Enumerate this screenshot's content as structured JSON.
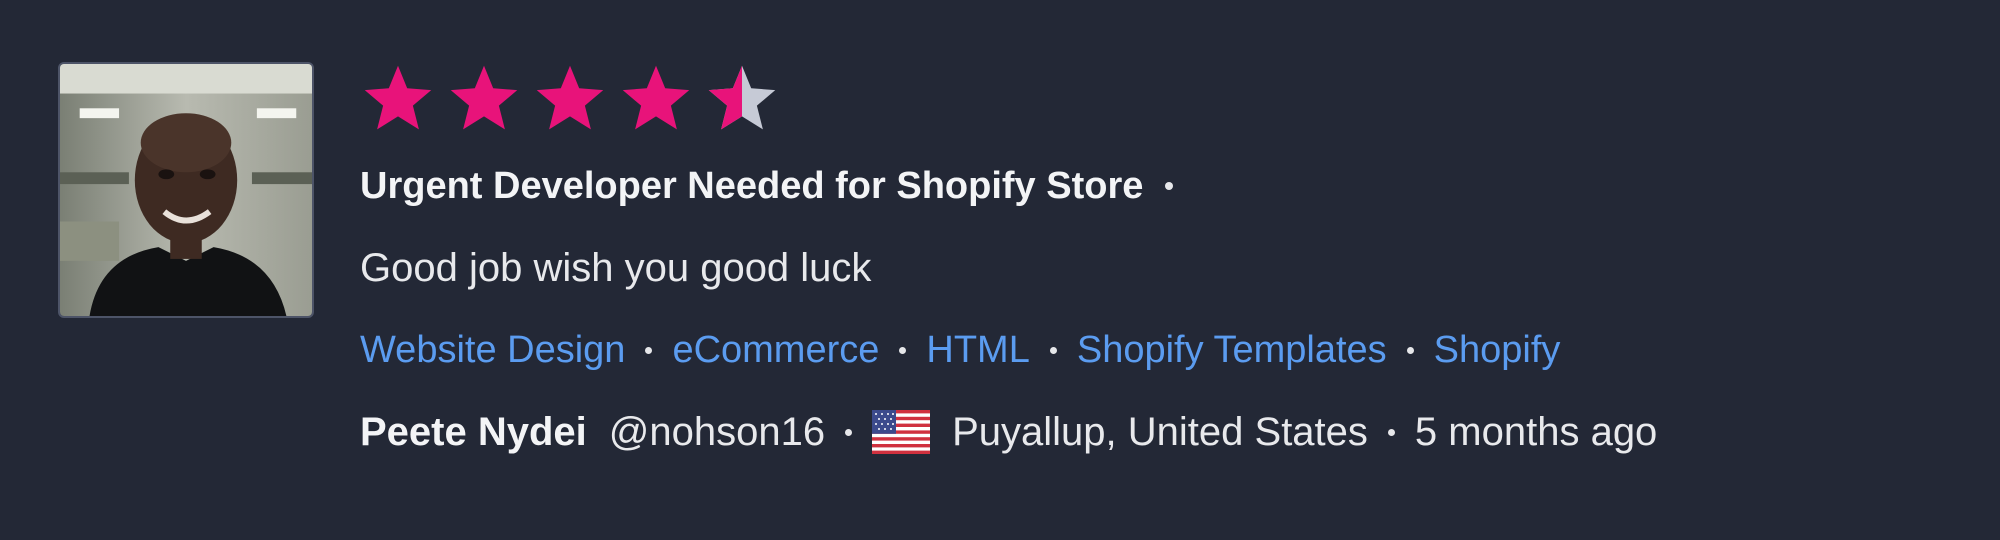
{
  "review": {
    "rating": 4.5,
    "max_rating": 5,
    "title": "Urgent Developer Needed for Shopify Store",
    "comment": "Good job wish you good luck",
    "tags": [
      "Website Design",
      "eCommerce",
      "HTML",
      "Shopify Templates",
      "Shopify"
    ],
    "reviewer": {
      "name": "Peete Nydei",
      "handle": "@nohson16",
      "country_flag_icon": "us-flag-icon",
      "location": "Puyallup, United States"
    },
    "time_ago": "5 months ago"
  },
  "colors": {
    "background": "#232836",
    "star_filled": "#e8137a",
    "star_empty": "#c6cad6",
    "tag_link": "#5b9cf0",
    "text": "#e8e9ec"
  }
}
